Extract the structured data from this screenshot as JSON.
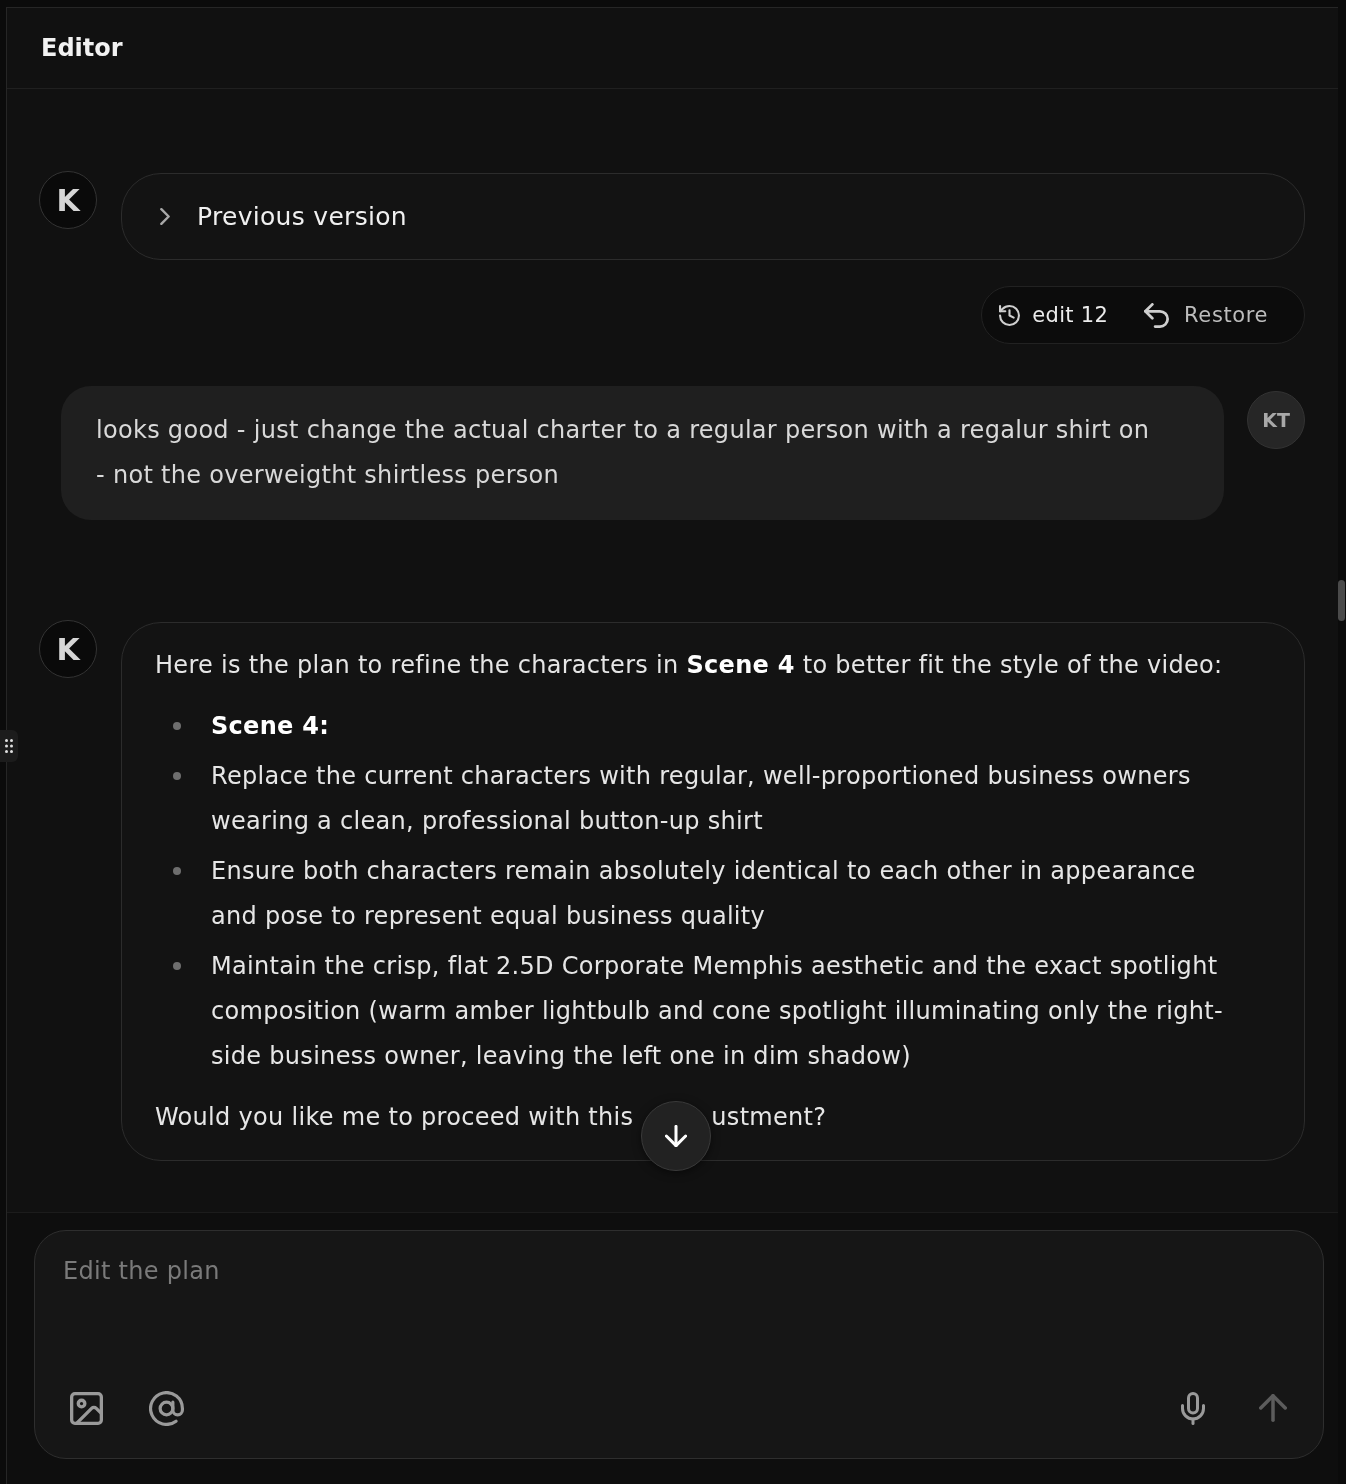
{
  "header": {
    "title": "Editor"
  },
  "messages": [
    {
      "kind": "assistant",
      "avatar": "K",
      "collapsed_title": "Previous version",
      "expanded": false
    },
    {
      "kind": "version",
      "label": "edit 12",
      "action": "Restore"
    },
    {
      "kind": "user",
      "avatar": "KT",
      "text": "looks good - just change the actual charter to a regular person with a regalur shirt on - not the overweigtht shirtless person"
    },
    {
      "kind": "assistant",
      "avatar": "K",
      "intro": "Here is the plan to refine the characters in **Scene 4** to better fit the style of the video:",
      "bullets": [
        {
          "text": "Scene 4:",
          "bold": true
        },
        {
          "text": "Replace the current characters with regular, well-proportioned business owners wearing a clean, professional button-up shirt",
          "bold": false
        },
        {
          "text": "Ensure both characters remain absolutely identical to each other in appearance and pose to represent equal business quality",
          "bold": false
        },
        {
          "text": "Maintain the crisp, flat 2.5D Corporate Memphis aesthetic and the exact spotlight composition (warm amber lightbulb and cone spotlight illuminating only the right-side business owner, leaving the left one in dim shadow)",
          "bold": false
        }
      ],
      "closing": [
        "Would you like me to proceed with this",
        "ustment?"
      ]
    }
  ],
  "composer": {
    "placeholder": "Edit the plan",
    "send": {
      "disabled": true
    }
  }
}
